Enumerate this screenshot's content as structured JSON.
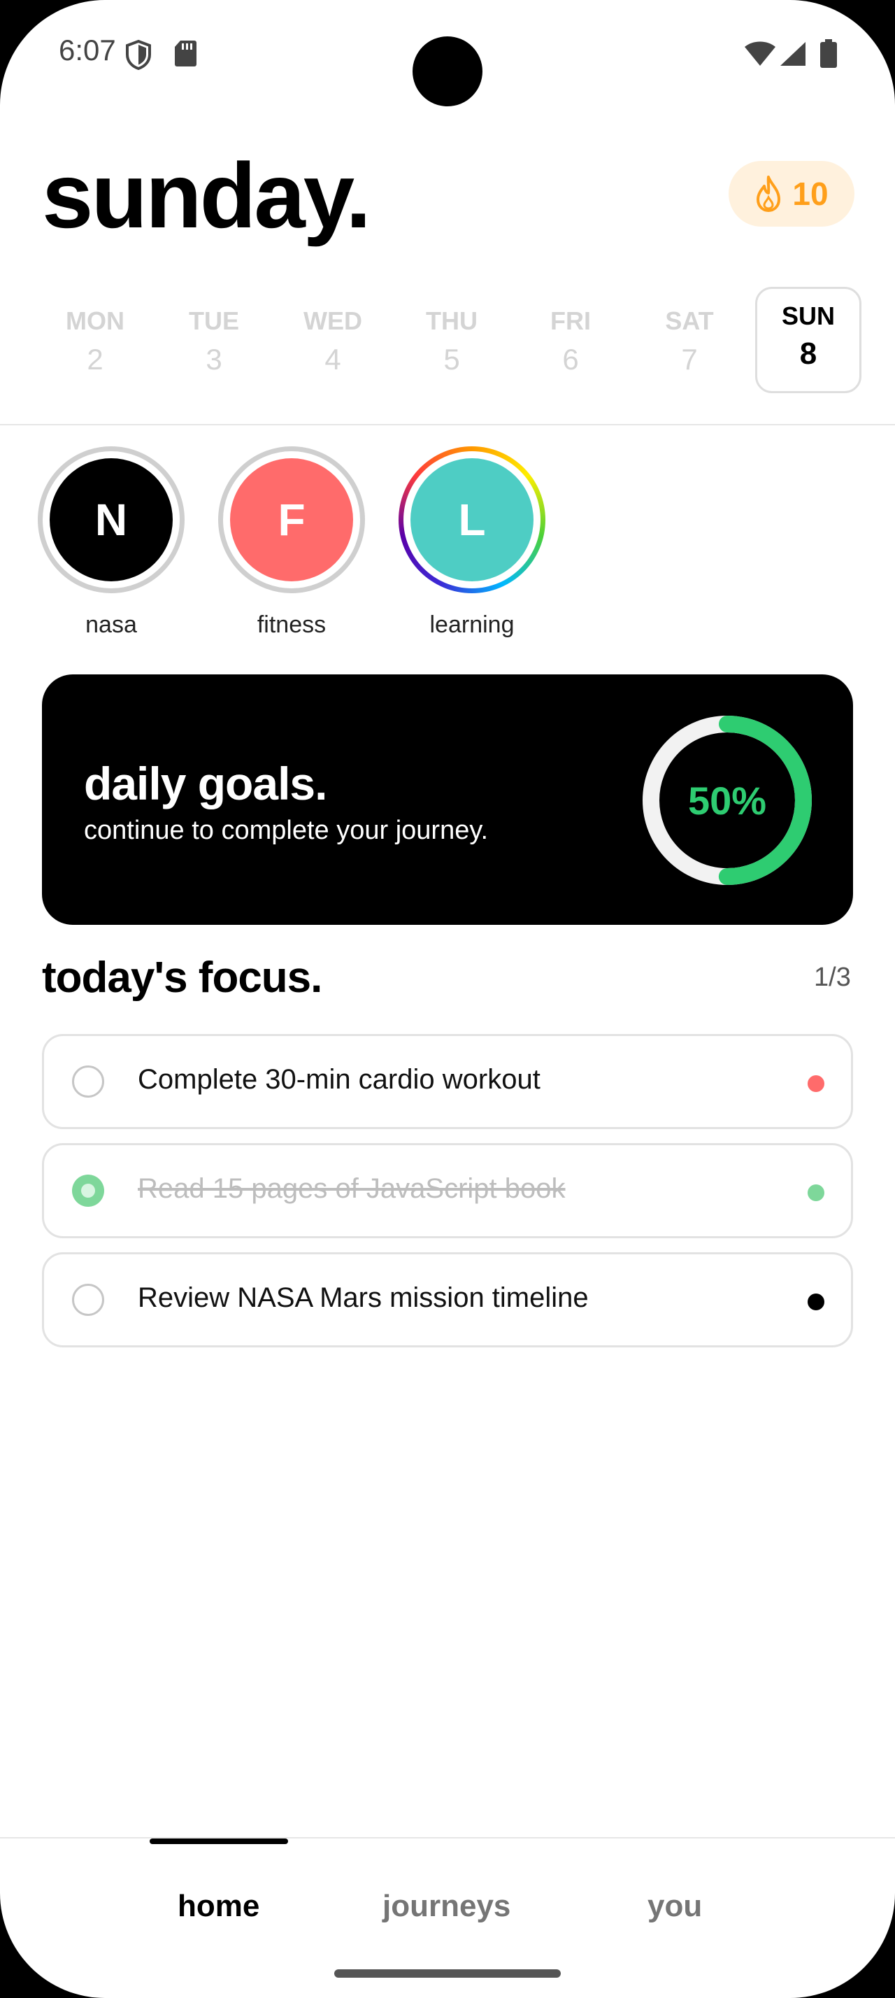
{
  "status_bar": {
    "time": "6:07"
  },
  "header": {
    "title": "sunday.",
    "streak": "10"
  },
  "week": [
    {
      "name": "MON",
      "num": "2"
    },
    {
      "name": "TUE",
      "num": "3"
    },
    {
      "name": "WED",
      "num": "4"
    },
    {
      "name": "THU",
      "num": "5"
    },
    {
      "name": "FRI",
      "num": "6"
    },
    {
      "name": "SAT",
      "num": "7"
    },
    {
      "name": "SUN",
      "num": "8",
      "active": true
    }
  ],
  "journeys": [
    {
      "initial": "N",
      "label": "nasa",
      "color": "#000000"
    },
    {
      "initial": "F",
      "label": "fitness",
      "color": "#FF6B6B"
    },
    {
      "initial": "L",
      "label": "learning",
      "color": "#4ECDC4"
    }
  ],
  "daily_goals": {
    "title": "daily goals.",
    "subtitle": "continue to complete your journey.",
    "progress_label": "50%",
    "progress": 0.5,
    "accent": "#2ECC71"
  },
  "focus": {
    "title": "today's focus.",
    "count": "1/3",
    "tasks": [
      {
        "label": "Complete 30-min cardio workout",
        "done": false,
        "dot_color": "#FF6B6B"
      },
      {
        "label": "Read 15 pages of JavaScript book",
        "done": true,
        "dot_color": "#7ED79A"
      },
      {
        "label": "Review NASA Mars mission timeline",
        "done": false,
        "dot_color": "#000000"
      }
    ]
  },
  "nav": {
    "home": "home",
    "journeys": "journeys",
    "you": "you",
    "active": "home"
  },
  "icons": {
    "shield": "shield-icon",
    "sdcard": "sd-card-icon",
    "wifi": "wifi-icon",
    "signal": "signal-icon",
    "battery": "battery-icon",
    "flame": "flame-icon"
  }
}
